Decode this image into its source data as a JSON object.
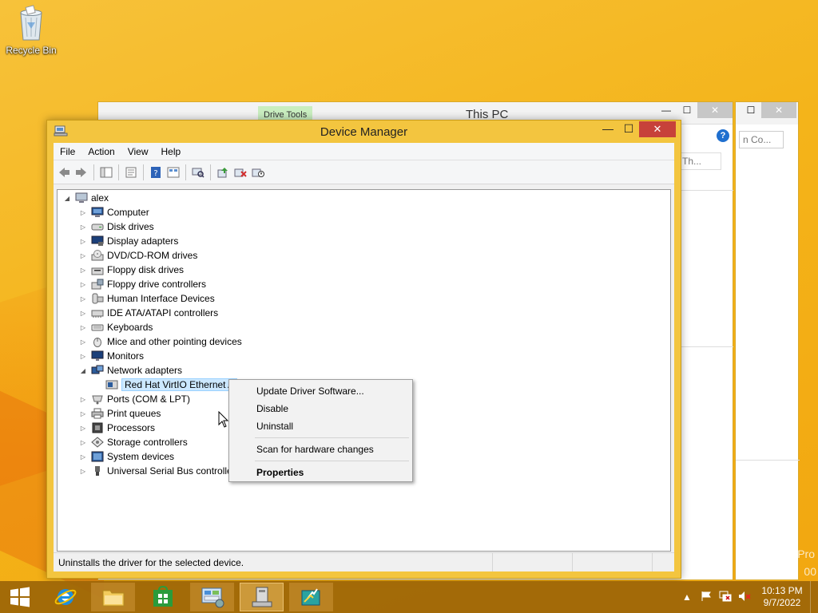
{
  "desktop": {
    "recycle_bin_label": "Recycle Bin",
    "watermark_line1": "Pro",
    "watermark_line2": "00"
  },
  "bg_explorer": {
    "tab_label": "Drive Tools",
    "title": "This PC",
    "search_placeholder": "Th...",
    "help_glyph": "?",
    "min_glyph": "—",
    "max_glyph": "☐",
    "close_glyph": "✕"
  },
  "bg_explorer2": {
    "search_placeholder": "n Co..."
  },
  "device_manager": {
    "title": "Device Manager",
    "min_glyph": "—",
    "max_glyph": "☐",
    "close_glyph": "✕",
    "menu": [
      "File",
      "Action",
      "View",
      "Help"
    ],
    "root": "alex",
    "tree": [
      {
        "label": "Computer",
        "icon": "computer-icon",
        "expanded": false
      },
      {
        "label": "Disk drives",
        "icon": "disk-drive-icon",
        "expanded": false
      },
      {
        "label": "Display adapters",
        "icon": "display-adapter-icon",
        "expanded": false
      },
      {
        "label": "DVD/CD-ROM drives",
        "icon": "dvd-drive-icon",
        "expanded": false
      },
      {
        "label": "Floppy disk drives",
        "icon": "floppy-drive-icon",
        "expanded": false
      },
      {
        "label": "Floppy drive controllers",
        "icon": "floppy-controller-icon",
        "expanded": false
      },
      {
        "label": "Human Interface Devices",
        "icon": "hid-icon",
        "expanded": false
      },
      {
        "label": "IDE ATA/ATAPI controllers",
        "icon": "ide-controller-icon",
        "expanded": false
      },
      {
        "label": "Keyboards",
        "icon": "keyboard-icon",
        "expanded": false
      },
      {
        "label": "Mice and other pointing devices",
        "icon": "mouse-icon",
        "expanded": false
      },
      {
        "label": "Monitors",
        "icon": "monitor-icon",
        "expanded": false
      },
      {
        "label": "Network adapters",
        "icon": "network-adapter-icon",
        "expanded": true
      },
      {
        "label": "Red Hat VirtIO Ethernet A",
        "icon": "network-card-icon",
        "child": true,
        "selected": true
      },
      {
        "label": "Ports (COM & LPT)",
        "icon": "port-icon",
        "expanded": false
      },
      {
        "label": "Print queues",
        "icon": "printer-icon",
        "expanded": false
      },
      {
        "label": "Processors",
        "icon": "processor-icon",
        "expanded": false
      },
      {
        "label": "Storage controllers",
        "icon": "storage-controller-icon",
        "expanded": false
      },
      {
        "label": "System devices",
        "icon": "system-device-icon",
        "expanded": false
      },
      {
        "label": "Universal Serial Bus controlle",
        "icon": "usb-icon",
        "expanded": false
      }
    ],
    "status_text": "Uninstalls the driver for the selected device."
  },
  "context_menu": {
    "items": [
      {
        "label": "Update Driver Software...",
        "bold": false
      },
      {
        "label": "Disable",
        "bold": false
      },
      {
        "label": "Uninstall",
        "bold": false
      },
      {
        "label": "Scan for hardware changes",
        "bold": false
      },
      {
        "label": "Properties",
        "bold": true
      }
    ]
  },
  "taskbar": {
    "time": "10:13 PM",
    "date": "9/7/2022"
  }
}
